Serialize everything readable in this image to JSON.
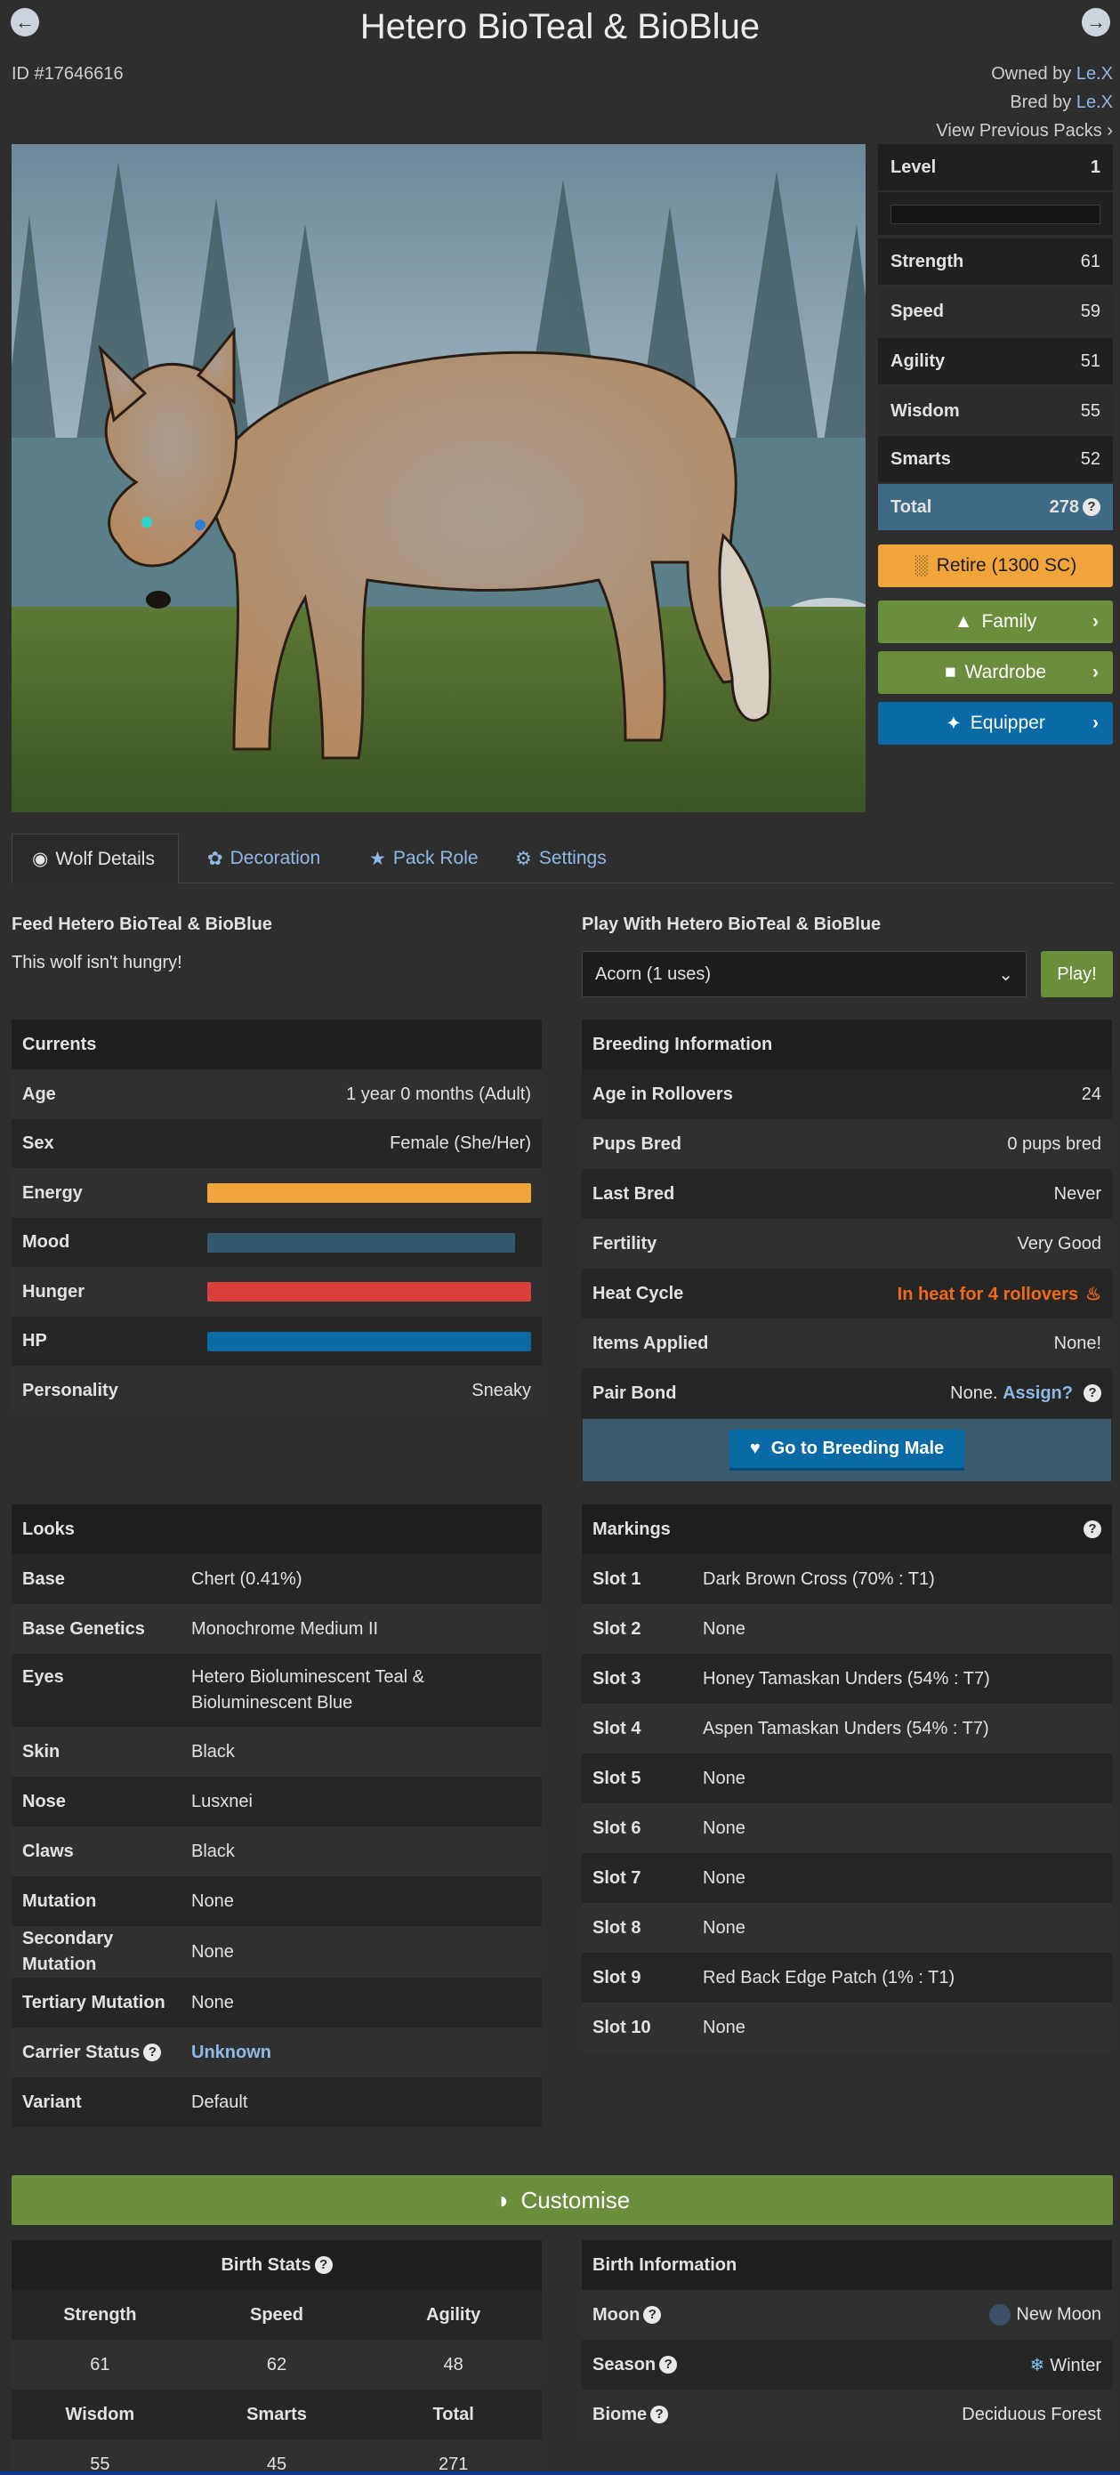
{
  "header": {
    "title": "Hetero BioTeal & BioBlue",
    "id": "ID #17646616",
    "owned_prefix": "Owned by",
    "owned_by": "Le.X",
    "bred_prefix": "Bred by",
    "bred_by": "Le.X",
    "view_previous_packs": "View Previous Packs"
  },
  "stats": {
    "level_label": "Level",
    "level": "1",
    "rows": [
      {
        "label": "Strength",
        "value": "61"
      },
      {
        "label": "Speed",
        "value": "59"
      },
      {
        "label": "Agility",
        "value": "51"
      },
      {
        "label": "Wisdom",
        "value": "55"
      },
      {
        "label": "Smarts",
        "value": "52"
      }
    ],
    "total_label": "Total",
    "total": "278"
  },
  "side_buttons": {
    "retire": "Retire (1300 SC)",
    "family": "Family",
    "wardrobe": "Wardrobe",
    "equipper": "Equipper"
  },
  "tabs": [
    "Wolf Details",
    "Decoration",
    "Pack Role",
    "Settings"
  ],
  "feed": {
    "title": "Feed Hetero BioTeal & BioBlue",
    "text": "This wolf isn't hungry!"
  },
  "play": {
    "title": "Play With Hetero BioTeal & BioBlue",
    "selected": "Acorn (1 uses)",
    "button": "Play!"
  },
  "currents": {
    "title": "Currents",
    "age_label": "Age",
    "age": "1 year 0 months (Adult)",
    "sex_label": "Sex",
    "sex": "Female (She/Her)",
    "energy_label": "Energy",
    "energy": 1.0,
    "mood_label": "Mood",
    "mood": 0.95,
    "hunger_label": "Hunger",
    "hunger": 1.0,
    "hp_label": "HP",
    "hp": 1.0,
    "personality_label": "Personality",
    "personality": "Sneaky"
  },
  "breeding": {
    "title": "Breeding Information",
    "rows": [
      {
        "label": "Age in Rollovers",
        "value": "24"
      },
      {
        "label": "Pups Bred",
        "value": "0 pups bred"
      },
      {
        "label": "Last Bred",
        "value": "Never"
      },
      {
        "label": "Fertility",
        "value": "Very Good"
      }
    ],
    "heat_label": "Heat Cycle",
    "heat": "In heat for 4 rollovers",
    "items_label": "Items Applied",
    "items": "None!",
    "pair_label": "Pair Bond",
    "pair": "None.",
    "assign": "Assign?",
    "go_button": "Go to Breeding Male"
  },
  "looks": {
    "title": "Looks",
    "rows": [
      {
        "label": "Base",
        "value": "Chert (0.41%)"
      },
      {
        "label": "Base Genetics",
        "value": "Monochrome Medium II"
      },
      {
        "label": "Eyes",
        "value": "Hetero Bioluminescent Teal & Bioluminescent Blue"
      },
      {
        "label": "Skin",
        "value": "Black"
      },
      {
        "label": "Nose",
        "value": "Lusxnei"
      },
      {
        "label": "Claws",
        "value": "Black"
      },
      {
        "label": "Mutation",
        "value": "None"
      },
      {
        "label": "Secondary Mutation",
        "value": "None"
      },
      {
        "label": "Tertiary Mutation",
        "value": "None"
      },
      {
        "label": "Carrier Status",
        "value": "Unknown"
      },
      {
        "label": "Variant",
        "value": "Default"
      }
    ]
  },
  "markings": {
    "title": "Markings",
    "rows": [
      {
        "label": "Slot 1",
        "value": "Dark Brown Cross (70% : T1)"
      },
      {
        "label": "Slot 2",
        "value": "None"
      },
      {
        "label": "Slot 3",
        "value": "Honey Tamaskan Unders (54% : T7)"
      },
      {
        "label": "Slot 4",
        "value": "Aspen Tamaskan Unders (54% : T7)"
      },
      {
        "label": "Slot 5",
        "value": "None"
      },
      {
        "label": "Slot 6",
        "value": "None"
      },
      {
        "label": "Slot 7",
        "value": "None"
      },
      {
        "label": "Slot 8",
        "value": "None"
      },
      {
        "label": "Slot 9",
        "value": "Red Back Edge Patch (1% : T1)"
      },
      {
        "label": "Slot 10",
        "value": "None"
      }
    ]
  },
  "customise": "Customise",
  "birth_stats": {
    "title": "Birth Stats",
    "h1": [
      "Strength",
      "Speed",
      "Agility"
    ],
    "v1": [
      "61",
      "62",
      "48"
    ],
    "h2": [
      "Wisdom",
      "Smarts",
      "Total"
    ],
    "v2": [
      "55",
      "45",
      "271"
    ]
  },
  "birth_info": {
    "title": "Birth Information",
    "moon_label": "Moon",
    "moon": "New Moon",
    "season_label": "Season",
    "season": "Winter",
    "biome_label": "Biome",
    "biome": "Deciduous Forest"
  },
  "colors": {
    "energy": "#f0a43a",
    "mood": "#34596e",
    "hunger": "#d7403c",
    "hp": "#0a6aa6",
    "retire": "#f0a43a",
    "green": "#6a8e3c",
    "blue": "#0a6aa6",
    "total": "#3e6a86",
    "heat": "#f06a1a"
  }
}
